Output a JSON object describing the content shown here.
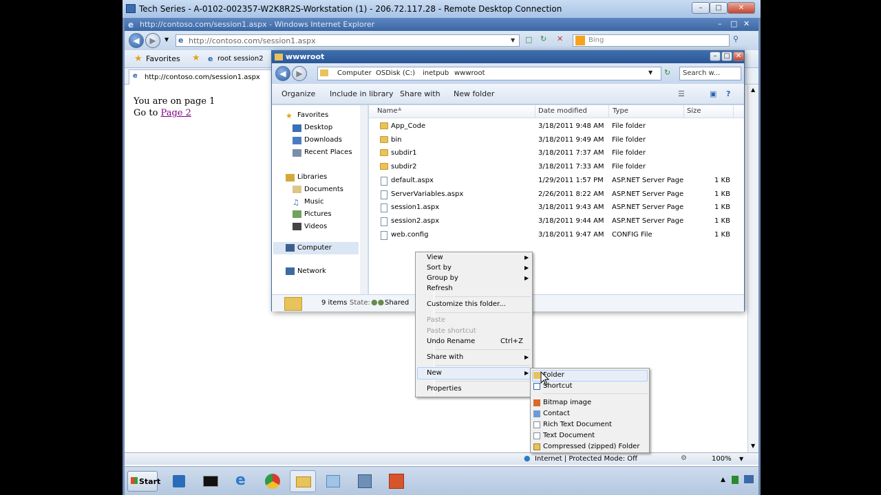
{
  "rdp": {
    "title": "Tech Series - A-0102-002357-W2K8R2S-Workstation (1) - 206.72.117.28 - Remote Desktop Connection"
  },
  "ie": {
    "title": "http://contoso.com/session1.aspx - Windows Internet Explorer",
    "address": "http://contoso.com/session1.aspx",
    "search_placeholder": "Bing",
    "favorites_label": "Favorites",
    "fav_item": "root session2",
    "tab_label": "http://contoso.com/session1.aspx",
    "page_line1": "You are on page 1",
    "page_line2_prefix": "Go to ",
    "page_link": "Page 2",
    "status_zone": "Internet | Protected Mode: Off",
    "zoom": "100%"
  },
  "explorer": {
    "title": "wwwroot",
    "breadcrumb": [
      "Computer",
      "OSDisk (C:)",
      "inetpub",
      "wwwroot"
    ],
    "search_placeholder": "Search w...",
    "toolbar": [
      "Organize",
      "Include in library",
      "Share with",
      "New folder"
    ],
    "nav": {
      "favorites": "Favorites",
      "fav_items": [
        "Desktop",
        "Downloads",
        "Recent Places"
      ],
      "libraries": "Libraries",
      "lib_items": [
        "Documents",
        "Music",
        "Pictures",
        "Videos"
      ],
      "computer": "Computer",
      "network": "Network"
    },
    "columns": [
      "Name",
      "Date modified",
      "Type",
      "Size"
    ],
    "files": [
      {
        "name": "App_Code",
        "date": "3/18/2011 9:48 AM",
        "type": "File folder",
        "size": "",
        "kind": "folder"
      },
      {
        "name": "bin",
        "date": "3/18/2011 9:49 AM",
        "type": "File folder",
        "size": "",
        "kind": "folder"
      },
      {
        "name": "subdir1",
        "date": "3/18/2011 7:37 AM",
        "type": "File folder",
        "size": "",
        "kind": "folder"
      },
      {
        "name": "subdir2",
        "date": "3/18/2011 7:33 AM",
        "type": "File folder",
        "size": "",
        "kind": "folder"
      },
      {
        "name": "default.aspx",
        "date": "1/29/2011 1:57 PM",
        "type": "ASP.NET Server Page",
        "size": "1 KB",
        "kind": "file"
      },
      {
        "name": "ServerVariables.aspx",
        "date": "2/26/2011 8:22 AM",
        "type": "ASP.NET Server Page",
        "size": "1 KB",
        "kind": "file"
      },
      {
        "name": "session1.aspx",
        "date": "3/18/2011 9:43 AM",
        "type": "ASP.NET Server Page",
        "size": "1 KB",
        "kind": "file"
      },
      {
        "name": "session2.aspx",
        "date": "3/18/2011 9:44 AM",
        "type": "ASP.NET Server Page",
        "size": "1 KB",
        "kind": "file"
      },
      {
        "name": "web.config",
        "date": "3/18/2011 9:47 AM",
        "type": "CONFIG File",
        "size": "1 KB",
        "kind": "file"
      }
    ],
    "details_count": "9 items",
    "details_state_label": "State:",
    "details_state_value": "Shared"
  },
  "context_menu": {
    "view": "View",
    "sort_by": "Sort by",
    "group_by": "Group by",
    "refresh": "Refresh",
    "customize": "Customize this folder...",
    "paste": "Paste",
    "paste_shortcut": "Paste shortcut",
    "undo": "Undo Rename",
    "undo_shortcut": "Ctrl+Z",
    "share_with": "Share with",
    "new": "New",
    "properties": "Properties"
  },
  "submenu": {
    "items": [
      "Folder",
      "Shortcut",
      "Bitmap image",
      "Contact",
      "Rich Text Document",
      "Text Document",
      "Compressed (zipped) Folder"
    ]
  },
  "taskbar": {
    "start": "Start"
  },
  "colors": {
    "accent": "#3c67a4",
    "folder": "#e8c25a",
    "link_visited": "#800080"
  }
}
